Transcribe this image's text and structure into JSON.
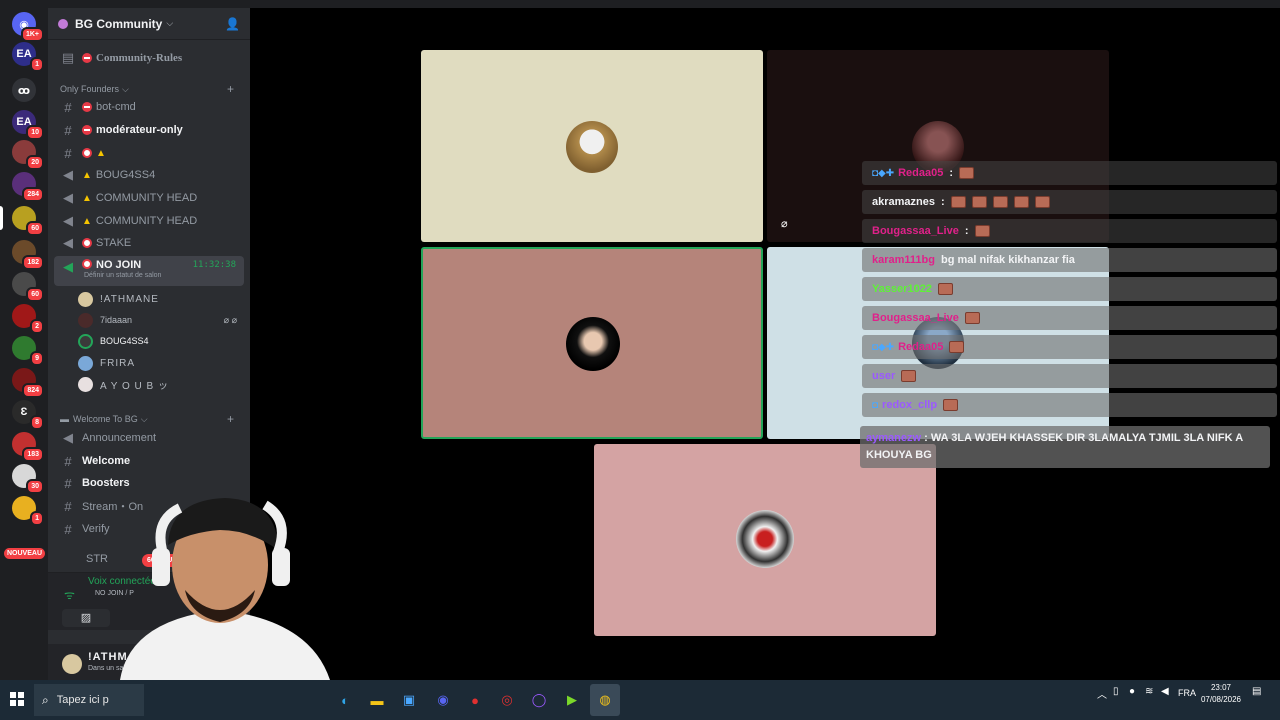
{
  "rail": {
    "home_badge": "1K+",
    "servers": [
      {
        "name": "EA",
        "badge": "1"
      },
      {
        "name": "",
        "badge": ""
      },
      {
        "name": "EA",
        "badge": "10"
      },
      {
        "name": "",
        "badge": "20"
      },
      {
        "name": "",
        "badge": "284"
      },
      {
        "name": "",
        "badge": "60"
      },
      {
        "name": "",
        "badge": "182"
      },
      {
        "name": "",
        "badge": "60"
      },
      {
        "name": "",
        "badge": "2"
      },
      {
        "name": "",
        "badge": "9"
      },
      {
        "name": "",
        "badge": "824"
      },
      {
        "name": "",
        "badge": "8"
      },
      {
        "name": "",
        "badge": "183"
      },
      {
        "name": "",
        "badge": "30"
      },
      {
        "name": "",
        "badge": "1"
      }
    ],
    "nouveau_label": "NOUVEAU"
  },
  "sidebar": {
    "guild_name": "BG Community",
    "channels_top": [
      {
        "name": "Community-Rules"
      }
    ],
    "category_founders": "Only Founders",
    "founders": [
      {
        "name": "bot-cmd"
      },
      {
        "name": "modérateur-only"
      },
      {
        "name": ""
      },
      {
        "name": "BOUG4SS4"
      },
      {
        "name": "COMMUNITY HEAD"
      },
      {
        "name": "COMMUNITY HEAD"
      },
      {
        "name": "STAKE"
      }
    ],
    "active_channel": {
      "name": "NO JOIN",
      "time": "11:32:38",
      "status": "Définir un statut de salon"
    },
    "voice_users": [
      {
        "name": "!ATHMANE"
      },
      {
        "name": "7idaaan"
      },
      {
        "name": "BOUG4SS4"
      },
      {
        "name": "FRIRA"
      },
      {
        "name": "A Y O U B ッ"
      }
    ],
    "category_welcome": "Welcome To BG",
    "welcome": [
      {
        "name": "Announcement"
      },
      {
        "name": "Welcome"
      },
      {
        "name": "Boosters"
      },
      {
        "name": "Stream・On"
      },
      {
        "name": "Verify"
      }
    ],
    "partial_channel": "STR",
    "new_pill": "60 NOUVEL",
    "voice_connected": "Voix connectée",
    "voice_channel": "NO JOIN / P",
    "me_name": "!ATHMAN",
    "me_status": "Dans un salon v"
  },
  "chat": [
    {
      "user": "Redaa05",
      "text": "",
      "color": "#e0218a",
      "emotes": 1
    },
    {
      "user": "akramaznes",
      "text": "",
      "color": "#f2f3f5",
      "emotes": 5
    },
    {
      "user": "Bougassaa_Live",
      "text": "",
      "color": "#e0218a",
      "emotes": 1
    },
    {
      "user": "karam111bg",
      "text": "bg mal nifak kikhanzar fia",
      "color": "#e0218a",
      "emotes": 0
    },
    {
      "user": "Yasser1022",
      "text": "",
      "color": "#5ef236",
      "emotes": 1
    },
    {
      "user": "Bougassaa_Live",
      "text": "",
      "color": "#e0218a",
      "emotes": 1
    },
    {
      "user": "Redaa05",
      "text": "",
      "color": "#e0218a",
      "emotes": 1
    },
    {
      "user": "user",
      "text": "",
      "color": "#9b59ff",
      "emotes": 1
    },
    {
      "user": "redox_cllp",
      "text": "",
      "color": "#9b59ff",
      "emotes": 1
    }
  ],
  "chat_long": {
    "user": "aymanezw",
    "text": "WA 3LA WJEH KHASSEK DIR 3LAMALYA TJMIL 3LA NIFK A KHOUYA BG"
  },
  "taskbar": {
    "search_placeholder": "Tapez ici p",
    "lang": "FRA",
    "time": "23:07",
    "date": "07/08/2026"
  },
  "colors": {
    "tile1": "#e0dcc0",
    "tile2": "#1a0f0f",
    "tile3": "#b5847a",
    "tile4": "#cfe0e6",
    "tile5": "#d4a3a3",
    "accent_green": "#23a559",
    "mention_red": "#f23f43"
  }
}
